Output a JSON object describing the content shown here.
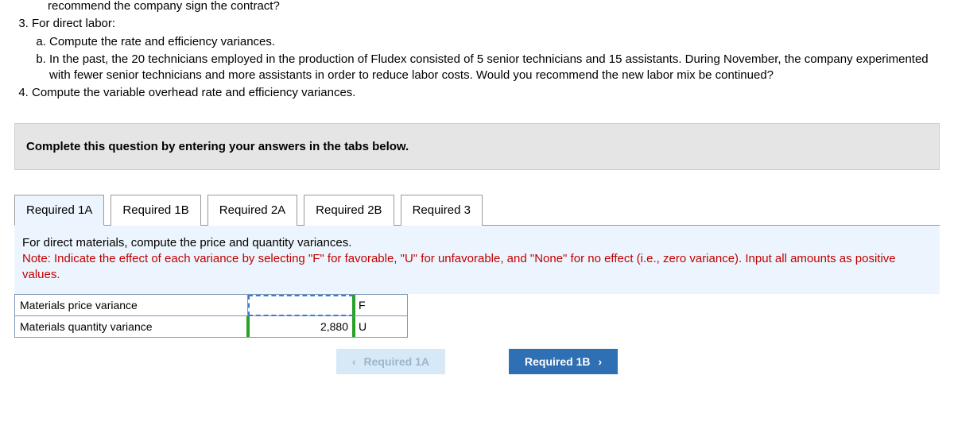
{
  "question": {
    "item1_tail": "recommend the company sign the contract?",
    "item2_intro": "For direct labor:",
    "item2_a": "Compute the rate and efficiency variances.",
    "item2_b": "In the past, the 20 technicians employed in the production of Fludex consisted of 5 senior technicians and 15 assistants. During November, the company experimented with fewer senior technicians and more assistants in order to reduce labor costs. Would you recommend the new labor mix be continued?",
    "item3": "Compute the variable overhead rate and efficiency variances."
  },
  "instruction": "Complete this question by entering your answers in the tabs below.",
  "tabs": [
    {
      "label": "Required 1A"
    },
    {
      "label": "Required 1B"
    },
    {
      "label": "Required 2A"
    },
    {
      "label": "Required 2B"
    },
    {
      "label": "Required 3"
    }
  ],
  "active_tab": 0,
  "panel": {
    "prompt_main": "For direct materials, compute the price and quantity variances.",
    "prompt_note": "Note: Indicate the effect of each variance by selecting \"F\" for favorable, \"U\" for unfavorable, and \"None\" for no effect (i.e., zero variance). Input all amounts as positive values."
  },
  "table": {
    "rows": [
      {
        "label": "Materials price variance",
        "amount": "",
        "effect": "F"
      },
      {
        "label": "Materials quantity variance",
        "amount": "2,880",
        "effect": "U"
      }
    ]
  },
  "nav": {
    "prev": "Required 1A",
    "next": "Required 1B"
  }
}
